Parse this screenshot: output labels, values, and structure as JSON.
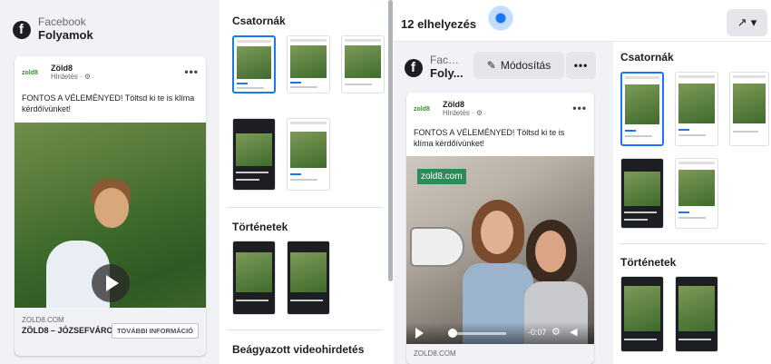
{
  "left": {
    "header": {
      "platform": "Facebook",
      "placement": "Folyamok"
    },
    "post": {
      "brand_logo": "zold8",
      "page_name": "Zöld8",
      "sponsored": "Hirdetés · ⚙",
      "more": "•••",
      "text": "FONTOS A VÉLEMÉNYED! Töltsd ki te is klíma kérdőívünket!",
      "domain": "ZOLD8.COM",
      "headline": "ZÖLD8 – JÓZSEFVÁROS",
      "cta": "TOVÁBBI INFORMÁCIÓ"
    },
    "sections": {
      "channels": "Csatornák",
      "stories": "Történetek",
      "embedded": "Beágyazott videohirdetés"
    }
  },
  "right": {
    "count": "12 elhelyezés",
    "open_icon": "↗",
    "header": {
      "platform": "Faceb...",
      "placement": "Foly..."
    },
    "edit_label": "Módosítás",
    "edit_icon": "✎",
    "more": "•••",
    "post": {
      "brand_logo": "zold8",
      "page_name": "Zöld8",
      "sponsored": "Hirdetés · ⚙",
      "more": "•••",
      "text": "FONTOS A VÉLEMÉNYED! Töltsd ki te is klíma kérdőívünket!",
      "sign": "zold8.com",
      "time": "-0:07",
      "domain": "ZOLD8.COM"
    },
    "sections": {
      "channels": "Csatornák",
      "stories": "Történetek"
    }
  },
  "colors": {
    "accent": "#1877f2",
    "background": "#f0f2f5"
  }
}
